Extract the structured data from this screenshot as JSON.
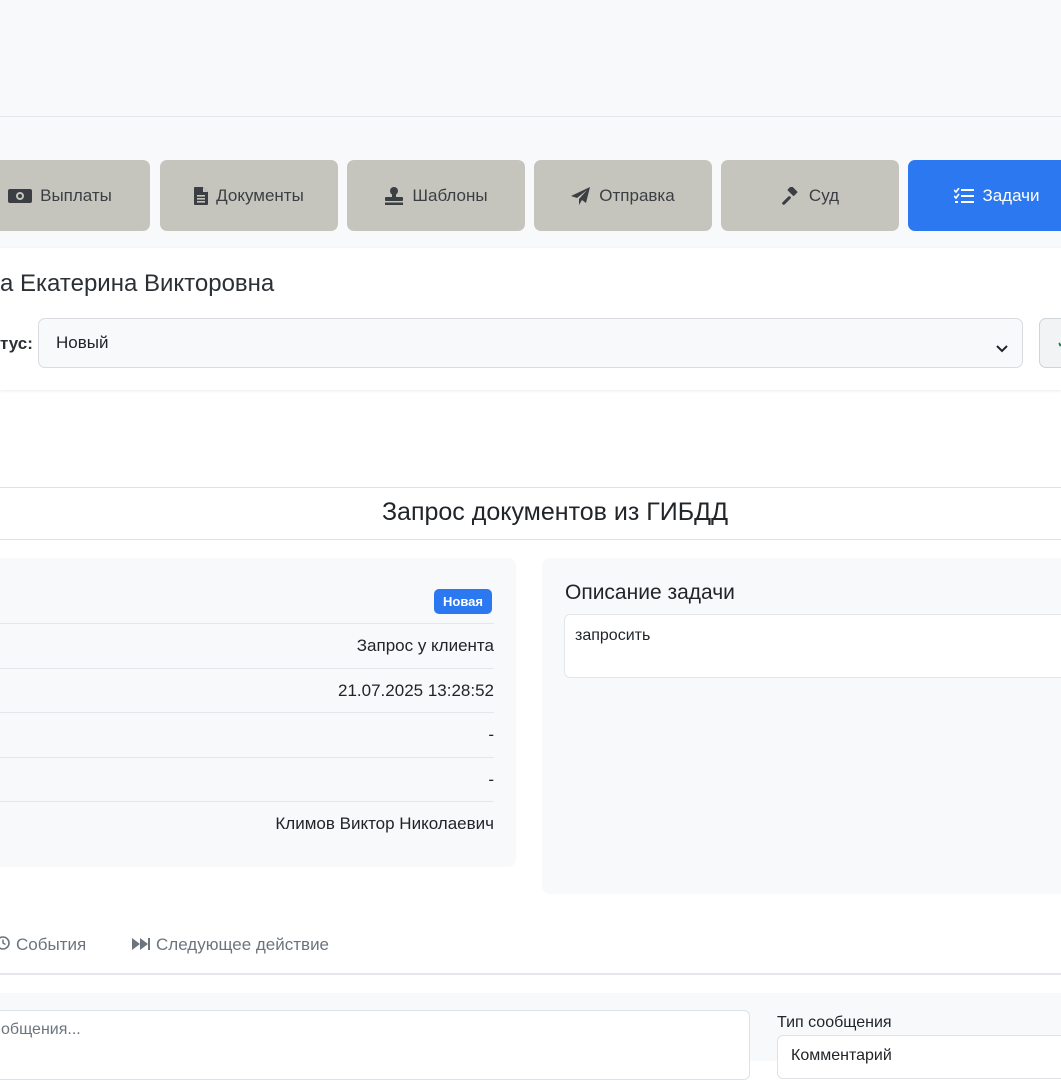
{
  "nav": {
    "tabs": [
      {
        "label": "Выплаты",
        "icon": "money-bill-icon"
      },
      {
        "label": "Документы",
        "icon": "file-icon"
      },
      {
        "label": "Шаблоны",
        "icon": "stamp-icon"
      },
      {
        "label": "Отправка",
        "icon": "paper-plane-icon"
      },
      {
        "label": "Суд",
        "icon": "gavel-icon"
      },
      {
        "label": "Задачи",
        "icon": "tasks-icon",
        "active": true
      }
    ]
  },
  "client": {
    "name": "а Екатерина Викторовна",
    "status_label": "тус:",
    "status_value": "Новый"
  },
  "task": {
    "title": "Запрос документов из ГИБДД",
    "badge": "Новая",
    "rows": [
      "Запрос у клиента",
      "21.07.2025 13:28:52",
      "-",
      "-",
      "Климов Виктор Николаевич"
    ],
    "description_title": "Описание задачи",
    "description": "запросить"
  },
  "tabs": {
    "events": "События",
    "next_action": "Следующее действие"
  },
  "message": {
    "placeholder": "общения...",
    "type_label": "Тип сообщения",
    "type_value": "Комментарий"
  },
  "colors": {
    "primary": "#2c78f0",
    "nav_inactive": "#c6c5bd",
    "panel_bg": "#f8f9fa"
  }
}
